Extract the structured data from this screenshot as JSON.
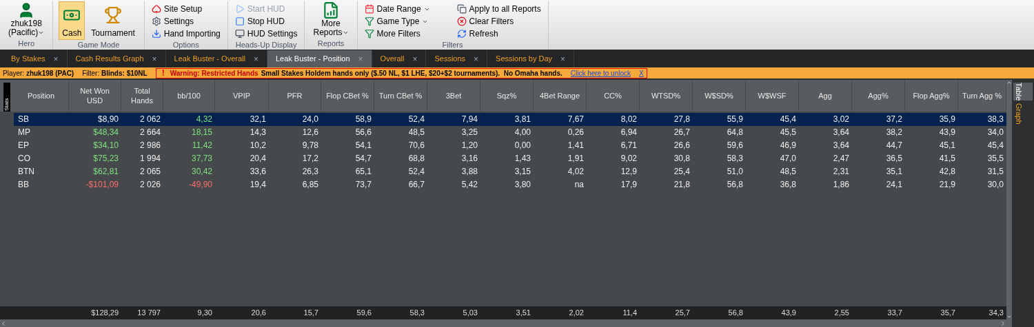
{
  "ribbon": {
    "groups": [
      {
        "kind": "hero",
        "label": "Hero",
        "user": "zhuk198",
        "site": "(Pacific)"
      },
      {
        "kind": "mode",
        "label": "Game Mode",
        "items": [
          {
            "label": "Cash",
            "selected": true
          },
          {
            "label": "Tournament",
            "selected": false
          }
        ]
      },
      {
        "kind": "list",
        "label": "Options",
        "items": [
          {
            "label": "Site Setup",
            "disabled": false,
            "dropdown": false
          },
          {
            "label": "Settings",
            "disabled": false,
            "dropdown": false
          },
          {
            "label": "Hand Importing",
            "disabled": false,
            "dropdown": false
          }
        ]
      },
      {
        "kind": "list",
        "label": "Heads-Up Display",
        "items": [
          {
            "label": "Start HUD",
            "disabled": true,
            "dropdown": false
          },
          {
            "label": "Stop HUD",
            "disabled": false,
            "dropdown": false
          },
          {
            "label": "HUD Settings",
            "disabled": false,
            "dropdown": false
          }
        ]
      },
      {
        "kind": "big",
        "label": "Reports",
        "button": {
          "label": "More Reports",
          "dropdown": true
        }
      },
      {
        "kind": "grid",
        "label": "Filters",
        "items": [
          {
            "label": "Date Range",
            "disabled": false,
            "dropdown": true
          },
          {
            "label": "Apply to all Reports",
            "disabled": false,
            "dropdown": false
          },
          {
            "label": "Game Type",
            "disabled": false,
            "dropdown": true
          },
          {
            "label": "Clear Filters",
            "disabled": false,
            "dropdown": false
          },
          {
            "label": "More Filters",
            "disabled": false,
            "dropdown": false
          },
          {
            "label": "Refresh",
            "disabled": false,
            "dropdown": false
          }
        ]
      }
    ]
  },
  "tabs": [
    {
      "label": "By Stakes",
      "selected": false
    },
    {
      "label": "Cash Results Graph",
      "selected": false
    },
    {
      "label": "Leak Buster - Overall",
      "selected": false
    },
    {
      "label": "Leak Buster - Position",
      "selected": true
    },
    {
      "label": "Overall",
      "selected": false
    },
    {
      "label": "Sessions",
      "selected": false
    },
    {
      "label": "Sessions by Day",
      "selected": false
    }
  ],
  "close_glyph": "×",
  "info_bar": {
    "player": "Player: **zhuk198 (PAC)**",
    "filter": "Filter: **Blinds: $10NL**",
    "warning": {
      "icon": "!",
      "title": "Warning: Restricted Hands",
      "message": "Small Stakes Holdem hands only ($.50 NL, $1 LHE, $20+$2 tournaments).  No Omaha hands.",
      "link": "Click here to unlock",
      "close": "X"
    }
  },
  "table": {
    "side_label": "Stats",
    "columns": [
      "Position",
      "Net Won USD",
      "Total Hands",
      "bb/100",
      "VPIP",
      "PFR",
      "Flop CBet %",
      "Turn CBet %",
      "3Bet",
      "Sqz%",
      "4Bet Range",
      "CC%",
      "WTSD%",
      "W$SD%",
      "W$WSF",
      "Agg",
      "Agg%",
      "Flop Agg%",
      "Turn Agg %"
    ],
    "rows": [
      {
        "selected": true,
        "color": "#7fe07f",
        "cells": [
          "SB",
          "$8,90",
          "2 062",
          "4,32",
          "32,1",
          "24,0",
          "58,9",
          "52,4",
          "7,94",
          "3,81",
          "7,67",
          "8,02",
          "27,8",
          "55,9",
          "45,4",
          "3,02",
          "37,2",
          "35,9",
          "38,3"
        ]
      },
      {
        "selected": false,
        "color": "#7fe07f",
        "cells": [
          "MP",
          "$48,34",
          "2 664",
          "18,15",
          "14,3",
          "12,6",
          "56,6",
          "48,5",
          "3,25",
          "4,00",
          "0,26",
          "6,94",
          "26,7",
          "64,8",
          "45,5",
          "3,64",
          "38,2",
          "43,9",
          "34,0"
        ]
      },
      {
        "selected": false,
        "color": "#7fe07f",
        "cells": [
          "EP",
          "$34,10",
          "2 986",
          "11,42",
          "10,2",
          "9,78",
          "54,1",
          "70,6",
          "1,20",
          "0,00",
          "1,41",
          "6,71",
          "26,6",
          "59,6",
          "46,9",
          "3,64",
          "44,7",
          "45,1",
          "45,4"
        ]
      },
      {
        "selected": false,
        "color": "#7fe07f",
        "cells": [
          "CO",
          "$75,23",
          "1 994",
          "37,73",
          "20,4",
          "17,2",
          "54,7",
          "68,8",
          "3,16",
          "1,43",
          "1,91",
          "9,02",
          "30,8",
          "58,3",
          "47,0",
          "2,47",
          "36,5",
          "41,5",
          "35,5"
        ]
      },
      {
        "selected": false,
        "color": "#7fe07f",
        "cells": [
          "BTN",
          "$62,81",
          "2 065",
          "30,42",
          "33,6",
          "26,3",
          "65,1",
          "52,4",
          "3,88",
          "3,15",
          "4,02",
          "12,9",
          "25,4",
          "51,0",
          "48,5",
          "2,31",
          "35,1",
          "42,8",
          "31,5"
        ]
      },
      {
        "selected": false,
        "color": "#ff6b6b",
        "cells": [
          "BB",
          "-$101,09",
          "2 026",
          "-49,90",
          "19,4",
          "6,85",
          "73,7",
          "66,7",
          "5,42",
          "3,80",
          "na",
          "17,9",
          "21,8",
          "56,8",
          "36,8",
          "1,86",
          "24,1",
          "21,9",
          "30,0"
        ]
      }
    ],
    "totals": [
      "$128,29",
      "13 797",
      "9,30",
      "20,6",
      "15,7",
      "59,6",
      "58,3",
      "5,03",
      "3,51",
      "2,02",
      "11,4",
      "25,7",
      "56,8",
      "43,9",
      "2,55",
      "33,7",
      "35,7",
      "34,3"
    ]
  },
  "side_tabs": [
    {
      "label": "Table",
      "selected": true
    },
    {
      "label": "Graph",
      "selected": false
    }
  ]
}
